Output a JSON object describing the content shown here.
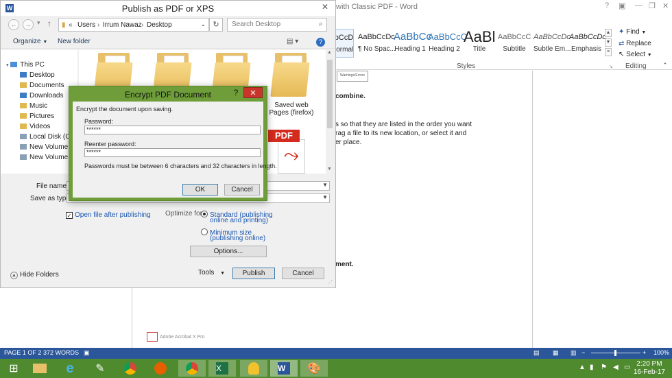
{
  "word": {
    "title": "with Classic PDF - Word",
    "styles": [
      {
        "preview": "AaBbCcDc",
        "name": "Normal"
      },
      {
        "preview": "AaBbCcDc",
        "name": "¶ No Spac..."
      },
      {
        "preview": "AaBbCc",
        "name": "Heading 1"
      },
      {
        "preview": "AaBbCcC",
        "name": "Heading 2"
      },
      {
        "preview": "AaBl",
        "name": "Title"
      },
      {
        "preview": "AaBbCcC",
        "name": "Subtitle"
      },
      {
        "preview": "AaBbCcDc",
        "name": "Subtle Em..."
      },
      {
        "preview": "AaBbCcDc",
        "name": "Emphasis"
      }
    ],
    "styles_group_label": "Styles",
    "editing": {
      "find": "Find",
      "replace": "Replace",
      "select": "Select",
      "group_label": "Editing"
    },
    "doc": {
      "warn_caption": "Warnings/Errors",
      "heading1": "combine.",
      "para1_line1": "s so that they are listed in the order you want",
      "para1_line2": "rag a file to its new location, or select it and",
      "para1_line3": "er place.",
      "heading2": "ment.",
      "acrobat": "Adobe Acrobat X Pro"
    },
    "status": {
      "page": "PAGE 1 OF 2",
      "words": "372 WORDS",
      "zoom": "100%"
    }
  },
  "taskbar": {
    "apps": [
      "windows-start",
      "file-explorer",
      "internet-explorer",
      "paint",
      "chrome",
      "firefox",
      "chrome-alt",
      "excel",
      "tips",
      "word",
      "paint-palette"
    ],
    "time": "2:20 PM",
    "date": "16-Feb-17"
  },
  "publish": {
    "title": "Publish as PDF or XPS",
    "path": [
      "Users",
      "Irrum Nawaz",
      "Desktop"
    ],
    "search_placeholder": "Search Desktop",
    "organize": "Organize",
    "new_folder": "New folder",
    "nav": [
      "This PC",
      "Desktop",
      "Documents",
      "Downloads",
      "Music",
      "Pictures",
      "Videos",
      "Local Disk (C:)",
      "New Volume (D",
      "New Volume (E"
    ],
    "files": {
      "saved_web_pages": "Saved web Pages (firefox)",
      "pdf_label": "PDF"
    },
    "file_name_label": "File name:",
    "save_as_type_label": "Save as type:",
    "open_after": "Open file after publishing",
    "optimize_label": "Optimize for:",
    "opt_standard": "Standard (publishing online and printing)",
    "opt_standard_l1": "Standard (publishing",
    "opt_standard_l2": "online and printing)",
    "opt_min_l1": "Minimum size",
    "opt_min_l2": "(publishing online)",
    "options_btn": "Options...",
    "hide_folders": "Hide Folders",
    "tools": "Tools",
    "publish_btn": "Publish",
    "cancel_btn": "Cancel"
  },
  "encrypt": {
    "title": "Encrypt PDF Document",
    "help": "?",
    "close": "✕",
    "subtitle": "Encrypt the document upon saving.",
    "password_label": "Password:",
    "password_value": "******",
    "reenter_label": "Reenter password:",
    "reenter_value": "******",
    "hint": "Passwords must be between 6 characters and 32 characters in length.",
    "ok": "OK",
    "cancel": "Cancel"
  }
}
